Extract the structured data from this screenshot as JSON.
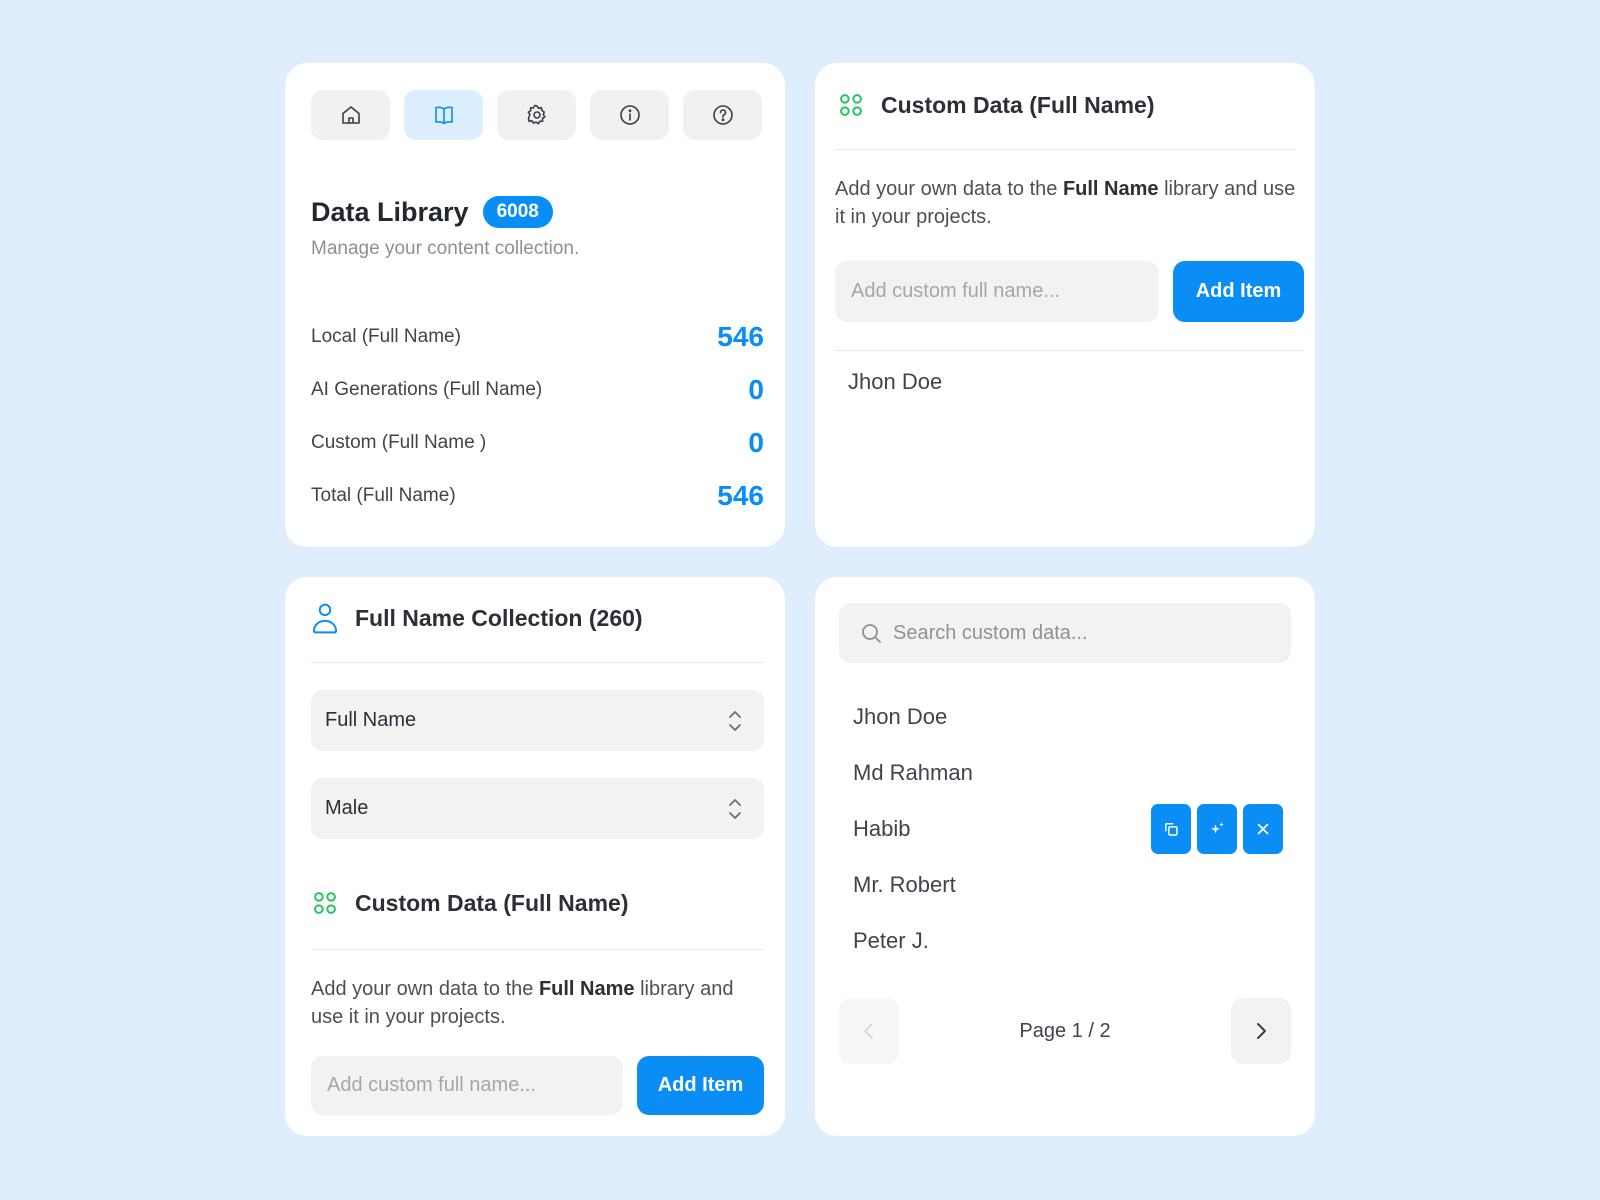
{
  "nav": {
    "items": [
      {
        "icon": "home-icon",
        "active": false
      },
      {
        "icon": "book-icon",
        "active": true
      },
      {
        "icon": "gear-icon",
        "active": false
      },
      {
        "icon": "info-icon",
        "active": false
      },
      {
        "icon": "help-icon",
        "active": false
      }
    ]
  },
  "library": {
    "title": "Data Library",
    "badge": "6008",
    "subtitle": "Manage your content collection.",
    "stats": [
      {
        "label": "Local (Full Name)",
        "value": "546"
      },
      {
        "label": "AI Generations (Full Name)",
        "value": "0"
      },
      {
        "label": "Custom (Full Name )",
        "value": "0"
      },
      {
        "label": "Total (Full Name)",
        "value": "546"
      }
    ]
  },
  "custom_card": {
    "title": "Custom Data (Full Name)",
    "desc_before": "Add your own data to the ",
    "desc_bold": "Full Name",
    "desc_after": " library and use it in your projects.",
    "input_placeholder": "Add custom full name...",
    "add_label": "Add Item",
    "entries": [
      "Jhon Doe"
    ]
  },
  "collection": {
    "title": "Full Name Collection (260)",
    "select_type": "Full Name",
    "select_gender": "Male",
    "custom_title": "Custom Data (Full Name)",
    "desc_before": "Add your own data to the ",
    "desc_bold": "Full Name",
    "desc_after": " library and use it in your projects.",
    "input_placeholder": "Add custom full name...",
    "add_label": "Add Item"
  },
  "search_card": {
    "placeholder": "Search custom data...",
    "items": [
      "Jhon Doe",
      "Md Rahman",
      "Habib",
      "Mr. Robert",
      "Peter J."
    ],
    "page_label": "Page 1 / 2"
  },
  "colors": {
    "accent": "#0a8ef5",
    "green_icon": "#22c55e",
    "background": "#e0edfd"
  }
}
